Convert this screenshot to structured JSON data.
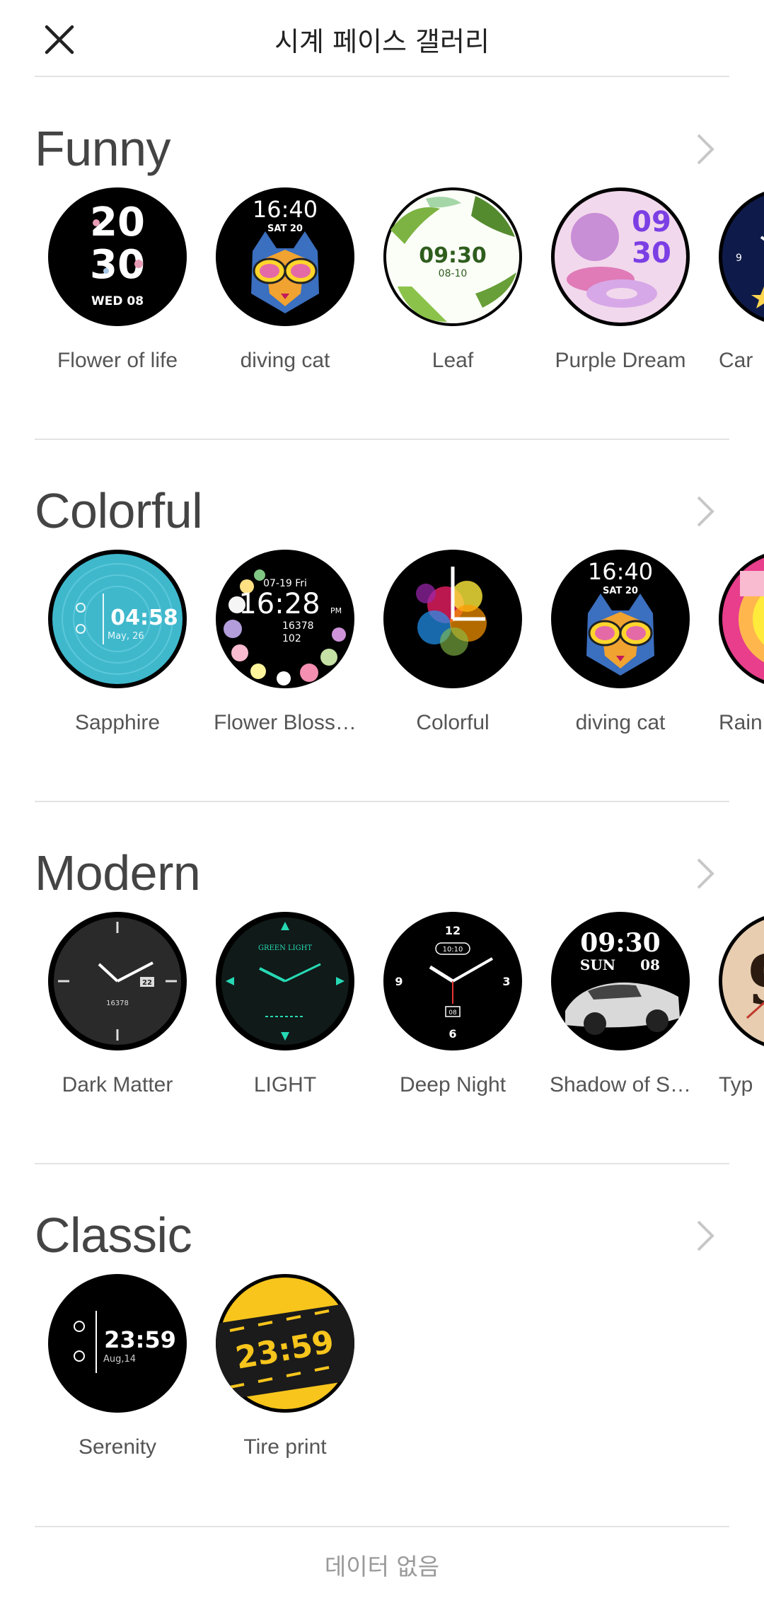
{
  "header": {
    "title": "시계 페이스 갤러리"
  },
  "sections": [
    {
      "title": "Funny",
      "items": [
        "Flower of life",
        "diving cat",
        "Leaf",
        "Purple Dream",
        "Car"
      ]
    },
    {
      "title": "Colorful",
      "items": [
        "Sapphire",
        "Flower Bloss…",
        "Colorful",
        "diving cat",
        "Rain"
      ]
    },
    {
      "title": "Modern",
      "items": [
        "Dark Matter",
        "LIGHT",
        "Deep Night",
        "Shadow of S…",
        "Typ"
      ]
    },
    {
      "title": "Classic",
      "items": [
        "Serenity",
        "Tire print"
      ]
    }
  ],
  "faces": {
    "flower_of_life": {
      "hour": "20",
      "minute": "30",
      "date": "WED 08"
    },
    "diving_cat": {
      "time": "16:40",
      "date": "SAT 20"
    },
    "leaf": {
      "time": "09:30",
      "date": "08-10"
    },
    "purple_dream": {
      "hour": "09",
      "minute": "30"
    },
    "sapphire": {
      "time": "04:58",
      "date": "May, 26"
    },
    "flower_blossom": {
      "date": "07-19 Fri",
      "time": "16:28",
      "pm": "PM",
      "steps": "16378",
      "heart": "102"
    },
    "dark_matter": {
      "date": "22",
      "steps": "16378"
    },
    "light": {
      "brand": "GREEN LIGHT"
    },
    "deep_night": {
      "n12": "12",
      "n3": "3",
      "n6": "6",
      "n9": "9",
      "digital": "10:10",
      "date": "08"
    },
    "shadow": {
      "time": "09:30",
      "day": "SUN",
      "date": "08"
    },
    "serenity": {
      "time": "23:59",
      "date": "Aug,14"
    },
    "tire_print": {
      "time": "23:59"
    }
  },
  "footer": {
    "text": "데이터 없음"
  }
}
